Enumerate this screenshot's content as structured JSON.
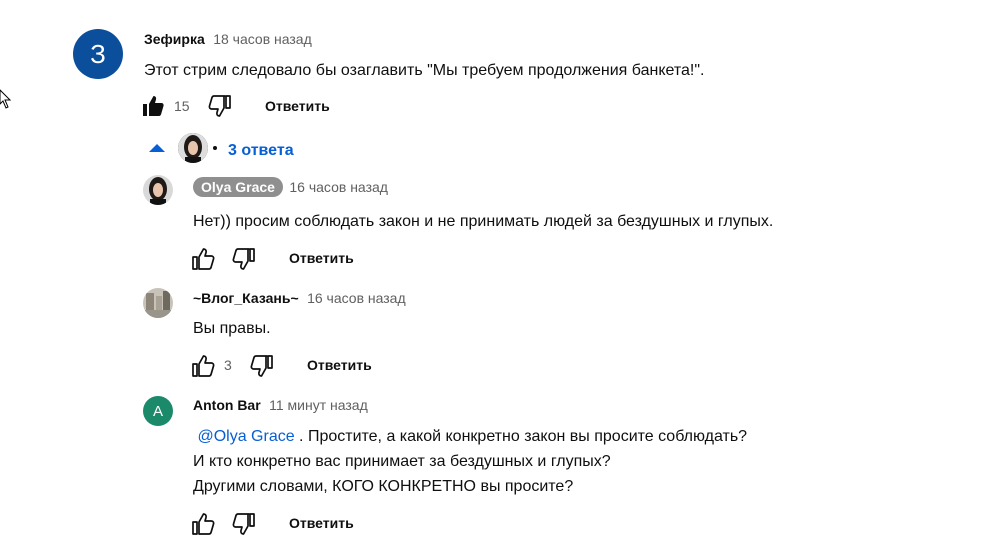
{
  "comment": {
    "avatar_letter": "З",
    "avatar_color": "#0b4f9c",
    "author": "Зефирка",
    "time": "18 часов назад",
    "text": "Этот стрим следовало бы озаглавить \"Мы требуем продолжения банкета!\".",
    "likes": "15",
    "reply_label": "Ответить",
    "replies_count_label": "3 ответа"
  },
  "replies": [
    {
      "author": "Olya Grace",
      "time": "16 часов назад",
      "text": "Нет)) просим соблюдать закон и не принимать людей за бездушных и глупых.",
      "likes": "",
      "reply_label": "Ответить"
    },
    {
      "author": "~Влог_Казань~",
      "time": "16 часов назад",
      "text": "Вы правы.",
      "likes": "3",
      "reply_label": "Ответить"
    },
    {
      "avatar_letter": "A",
      "avatar_color": "#1b8a6b",
      "author": "Anton Bar",
      "time": "11 минут назад",
      "mention": "@Olya Grace",
      "text_line1_rest": " . Простите, а какой конкретно закон вы просите соблюдать?",
      "text_line2": "И кто конкретно вас принимает за бездушных и глупых?",
      "text_line3": "Другими словами, КОГО КОНКРЕТНО  вы просите?",
      "reply_label": "Ответить"
    }
  ],
  "icons": {
    "like": "thumbs-up-icon",
    "dislike": "thumbs-down-icon",
    "expand": "caret-up-icon",
    "cursor": "mouse-cursor-icon"
  }
}
